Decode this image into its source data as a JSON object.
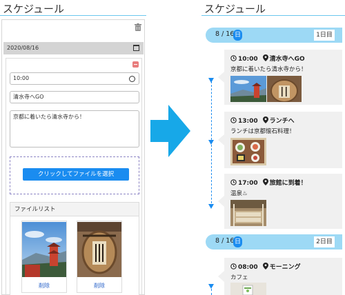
{
  "editor": {
    "title": "スケジュール",
    "date_value": "2020/08/16",
    "time_value": "10:00",
    "title_value": "清水寺へGO",
    "note_value": "京都に着いたら清水寺から！",
    "file_button_label": "クリックしてファイルを選択",
    "file_list_header": "ファイルリスト",
    "files": [
      {
        "delete_label": "削除",
        "icon": "kyoto-pagoda-photo"
      },
      {
        "delete_label": "削除",
        "icon": "sake-barrel-photo"
      }
    ]
  },
  "timeline": {
    "title": "スケジュール",
    "accent_color": "#1a8cf0",
    "header_color": "#9dd9f5",
    "days": [
      {
        "date": "8 / 16",
        "weekday": "日",
        "day_label": "1日目",
        "events": [
          {
            "time": "10:00",
            "place": "清水寺へGO",
            "note": "京都に着いたら清水寺から！"
          },
          {
            "time": "13:00",
            "place": "ランチへ",
            "note": "ランチは京都懐石料理！"
          },
          {
            "time": "17:00",
            "place": "旅館に到着！",
            "note": "温泉♨"
          }
        ]
      },
      {
        "date": "8 / 16",
        "weekday": "日",
        "day_label": "2日目",
        "events": [
          {
            "time": "08:00",
            "place": "モーニング",
            "note": "カフェ"
          }
        ]
      }
    ]
  }
}
